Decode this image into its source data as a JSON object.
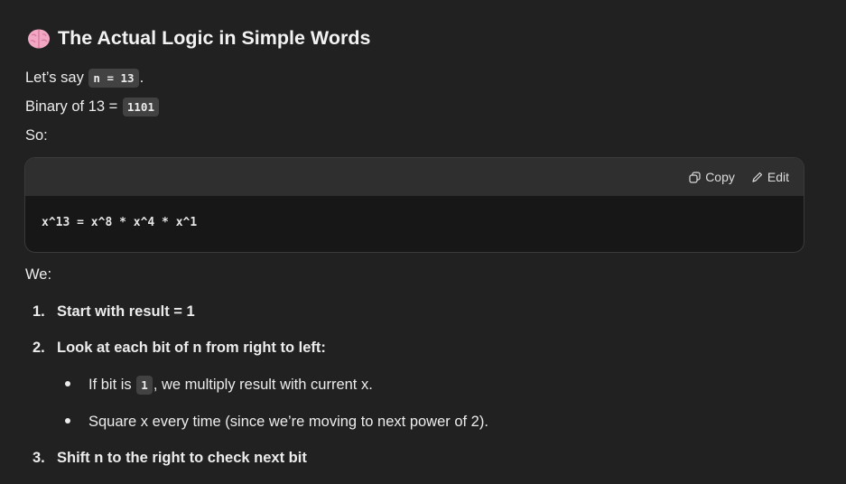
{
  "heading": {
    "text": "The Actual Logic in Simple Words",
    "icon": "brain-emoji-icon"
  },
  "intro": {
    "lets_say_prefix": "Let’s say",
    "lets_say_code": "n = 13",
    "lets_say_suffix": ".",
    "binary_prefix": "Binary of 13 =",
    "binary_code": "1101",
    "so": "So:"
  },
  "codeblock": {
    "copy_label": "Copy",
    "edit_label": "Edit",
    "code": "x^13 = x^8 * x^4 * x^1"
  },
  "we": "We:",
  "steps": [
    {
      "num": "1.",
      "text": "Start with result = 1"
    },
    {
      "num": "2.",
      "text": "Look at each bit of n from right to left:"
    },
    {
      "num": "3.",
      "text": "Shift n to the right to check next bit"
    }
  ],
  "bullets": {
    "b1_prefix": "If bit is",
    "b1_code": "1",
    "b1_suffix": ", we multiply result with current x.",
    "b2": "Square x every time (since we’re moving to next power of 2)."
  }
}
